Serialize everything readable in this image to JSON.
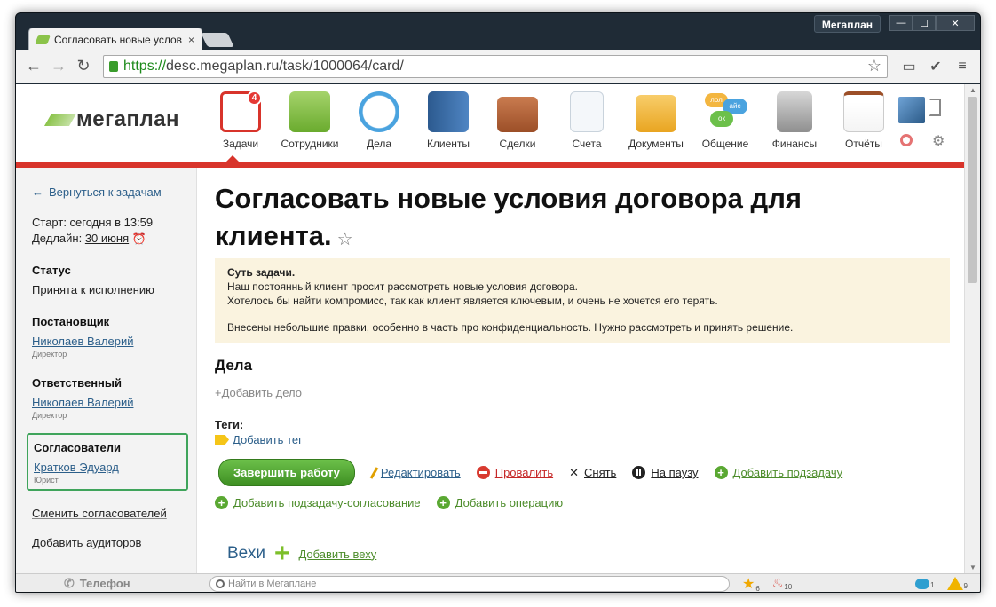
{
  "window": {
    "app_name": "Мегаплан",
    "min": "—",
    "max": "☐",
    "close": "✕"
  },
  "tab": {
    "title": "Согласовать новые услов",
    "close": "×"
  },
  "url": {
    "scheme": "https://",
    "rest": "desc.megaplan.ru/task/1000064/card/"
  },
  "logo": {
    "text": "мегаплан"
  },
  "modules": [
    {
      "label": "Задачи",
      "badge": "4",
      "color": "#d8342b"
    },
    {
      "label": "Сотрудники",
      "color": "#8bc34a"
    },
    {
      "label": "Дела",
      "color": "#4aa3df"
    },
    {
      "label": "Клиенты",
      "color": "#3b6fa8"
    },
    {
      "label": "Сделки",
      "color": "#b8643a"
    },
    {
      "label": "Счета",
      "color": "#dfe6ec"
    },
    {
      "label": "Документы",
      "color": "#f3b640"
    },
    {
      "label": "Общение",
      "color": "#6cc04a",
      "bubbles": [
        "лол",
        "айс",
        "ок"
      ]
    },
    {
      "label": "Финансы",
      "color": "#9e9e9e"
    },
    {
      "label": "Отчёты",
      "color": "#e84f3d"
    }
  ],
  "sidebar": {
    "back": "Вернуться к задачам",
    "start_label": "Старт: сегодня в 13:59",
    "deadline_label": "Дедлайн:",
    "deadline_date": "30 июня",
    "status_head": "Статус",
    "status_value": "Принята к исполнению",
    "owner_head": "Постановщик",
    "owner_name": "Николаев Валерий",
    "owner_role": "Директор",
    "resp_head": "Ответственный",
    "resp_name": "Николаев Валерий",
    "resp_role": "Директор",
    "approvers_head": "Согласователи",
    "approver_name": "Кратков Эдуард",
    "approver_role": "Юрист",
    "change_approvers": "Сменить согласователей",
    "add_auditors": "Добавить аудиторов"
  },
  "task": {
    "title": "Согласовать новые условия договора для клиента.",
    "essence_head": "Суть задачи.",
    "essence_lines": [
      "Наш постоянный клиент просит рассмотреть новые условия договора.",
      "Хотелось бы найти компромисс, так как клиент является ключевым, и очень не хочется его терять.",
      "Внесены небольшие правки, особенно в часть про конфиденциальность. Нужно рассмотреть и принять решение."
    ],
    "deals_head": "Дела",
    "add_deal": "Добавить дело",
    "tags_head": "Теги:",
    "add_tag": "Добавить тег"
  },
  "actions": {
    "complete": "Завершить работу",
    "edit": "Редактировать",
    "fail": "Провалить",
    "remove": "Снять",
    "pause": "На паузу",
    "add_subtask": "Добавить подзадачу",
    "add_approval_subtask": "Добавить подзадачу-согласование",
    "add_operation": "Добавить операцию"
  },
  "milestones": {
    "head": "Вехи",
    "add": "Добавить веху"
  },
  "statusbar": {
    "phone": "Телефон",
    "search_placeholder": "Найти в Мегаплане",
    "stars": "6",
    "fire": "10",
    "chats": "1",
    "warnings": "9"
  }
}
